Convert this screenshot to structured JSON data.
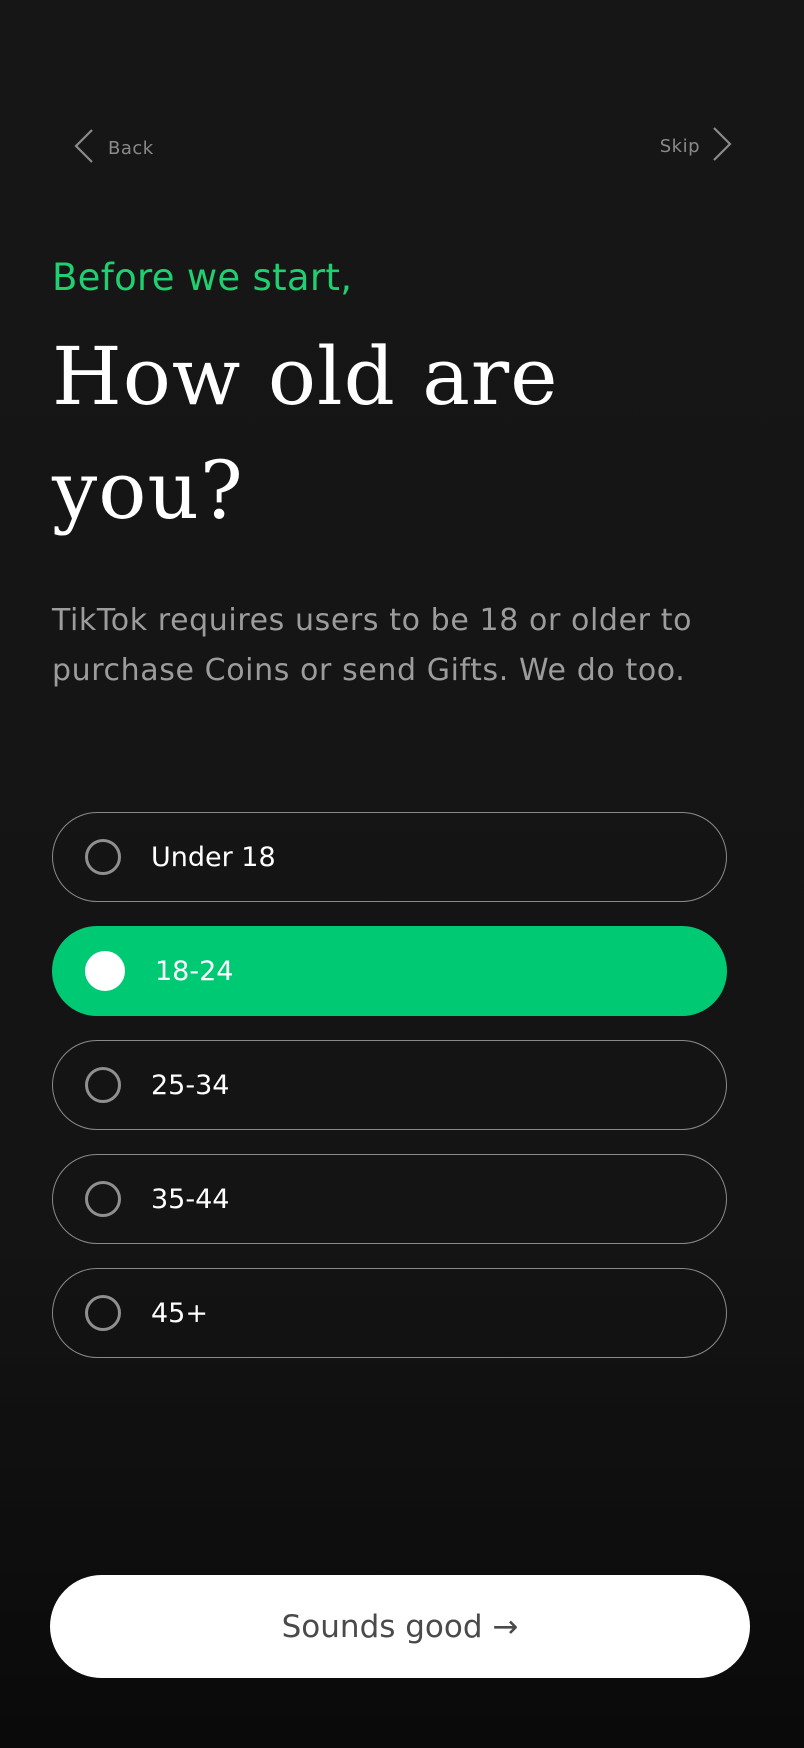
{
  "nav": {
    "back_label": "Back",
    "skip_label": "Skip"
  },
  "intro": {
    "eyebrow": "Before we start,",
    "headline": "How old are you?",
    "subtitle": "TikTok requires users to be 18 or older to purchase Coins or send Gifts. We do too."
  },
  "age_options": {
    "items": [
      {
        "label": "Under 18",
        "selected": false
      },
      {
        "label": "18-24",
        "selected": true
      },
      {
        "label": "25-34",
        "selected": false
      },
      {
        "label": "35-44",
        "selected": false
      },
      {
        "label": "45+",
        "selected": false
      }
    ]
  },
  "cta": {
    "label": "Sounds good →"
  },
  "colors": {
    "accent": "#00c974",
    "eyebrow": "#1fcf70",
    "background": "#141414",
    "button_bg": "#ffffff"
  },
  "icons": {
    "back": "chevron-left-icon",
    "skip": "chevron-right-icon",
    "radio": "radio-circle-icon"
  }
}
